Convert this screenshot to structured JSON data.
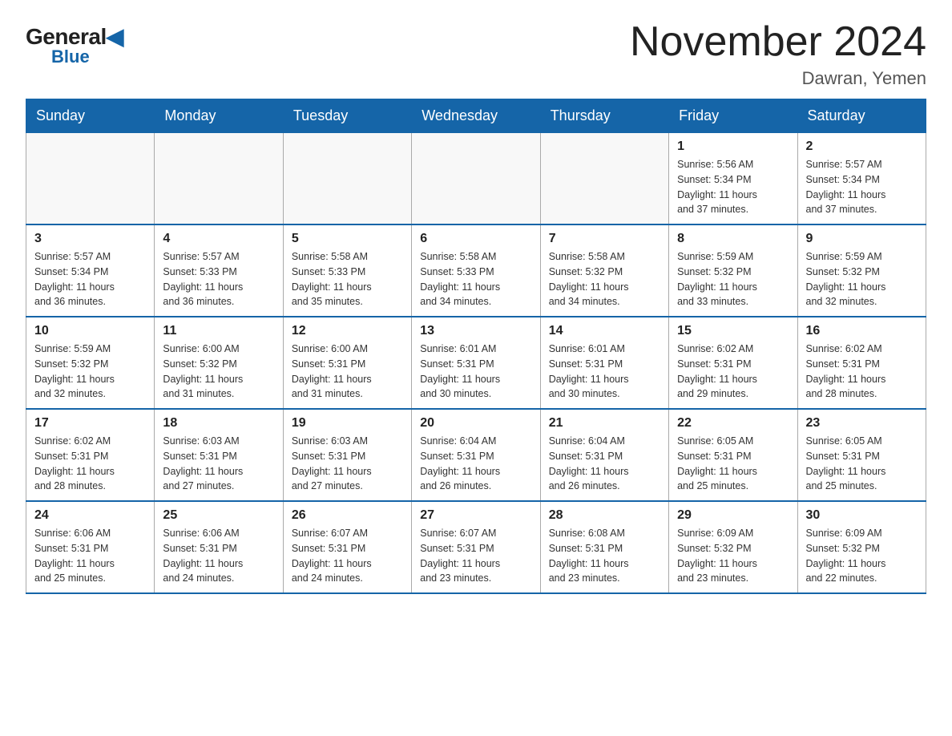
{
  "header": {
    "logo_general": "General",
    "logo_blue": "Blue",
    "month_title": "November 2024",
    "location": "Dawran, Yemen"
  },
  "days_of_week": [
    "Sunday",
    "Monday",
    "Tuesday",
    "Wednesday",
    "Thursday",
    "Friday",
    "Saturday"
  ],
  "weeks": [
    [
      {
        "day": "",
        "info": ""
      },
      {
        "day": "",
        "info": ""
      },
      {
        "day": "",
        "info": ""
      },
      {
        "day": "",
        "info": ""
      },
      {
        "day": "",
        "info": ""
      },
      {
        "day": "1",
        "info": "Sunrise: 5:56 AM\nSunset: 5:34 PM\nDaylight: 11 hours\nand 37 minutes."
      },
      {
        "day": "2",
        "info": "Sunrise: 5:57 AM\nSunset: 5:34 PM\nDaylight: 11 hours\nand 37 minutes."
      }
    ],
    [
      {
        "day": "3",
        "info": "Sunrise: 5:57 AM\nSunset: 5:34 PM\nDaylight: 11 hours\nand 36 minutes."
      },
      {
        "day": "4",
        "info": "Sunrise: 5:57 AM\nSunset: 5:33 PM\nDaylight: 11 hours\nand 36 minutes."
      },
      {
        "day": "5",
        "info": "Sunrise: 5:58 AM\nSunset: 5:33 PM\nDaylight: 11 hours\nand 35 minutes."
      },
      {
        "day": "6",
        "info": "Sunrise: 5:58 AM\nSunset: 5:33 PM\nDaylight: 11 hours\nand 34 minutes."
      },
      {
        "day": "7",
        "info": "Sunrise: 5:58 AM\nSunset: 5:32 PM\nDaylight: 11 hours\nand 34 minutes."
      },
      {
        "day": "8",
        "info": "Sunrise: 5:59 AM\nSunset: 5:32 PM\nDaylight: 11 hours\nand 33 minutes."
      },
      {
        "day": "9",
        "info": "Sunrise: 5:59 AM\nSunset: 5:32 PM\nDaylight: 11 hours\nand 32 minutes."
      }
    ],
    [
      {
        "day": "10",
        "info": "Sunrise: 5:59 AM\nSunset: 5:32 PM\nDaylight: 11 hours\nand 32 minutes."
      },
      {
        "day": "11",
        "info": "Sunrise: 6:00 AM\nSunset: 5:32 PM\nDaylight: 11 hours\nand 31 minutes."
      },
      {
        "day": "12",
        "info": "Sunrise: 6:00 AM\nSunset: 5:31 PM\nDaylight: 11 hours\nand 31 minutes."
      },
      {
        "day": "13",
        "info": "Sunrise: 6:01 AM\nSunset: 5:31 PM\nDaylight: 11 hours\nand 30 minutes."
      },
      {
        "day": "14",
        "info": "Sunrise: 6:01 AM\nSunset: 5:31 PM\nDaylight: 11 hours\nand 30 minutes."
      },
      {
        "day": "15",
        "info": "Sunrise: 6:02 AM\nSunset: 5:31 PM\nDaylight: 11 hours\nand 29 minutes."
      },
      {
        "day": "16",
        "info": "Sunrise: 6:02 AM\nSunset: 5:31 PM\nDaylight: 11 hours\nand 28 minutes."
      }
    ],
    [
      {
        "day": "17",
        "info": "Sunrise: 6:02 AM\nSunset: 5:31 PM\nDaylight: 11 hours\nand 28 minutes."
      },
      {
        "day": "18",
        "info": "Sunrise: 6:03 AM\nSunset: 5:31 PM\nDaylight: 11 hours\nand 27 minutes."
      },
      {
        "day": "19",
        "info": "Sunrise: 6:03 AM\nSunset: 5:31 PM\nDaylight: 11 hours\nand 27 minutes."
      },
      {
        "day": "20",
        "info": "Sunrise: 6:04 AM\nSunset: 5:31 PM\nDaylight: 11 hours\nand 26 minutes."
      },
      {
        "day": "21",
        "info": "Sunrise: 6:04 AM\nSunset: 5:31 PM\nDaylight: 11 hours\nand 26 minutes."
      },
      {
        "day": "22",
        "info": "Sunrise: 6:05 AM\nSunset: 5:31 PM\nDaylight: 11 hours\nand 25 minutes."
      },
      {
        "day": "23",
        "info": "Sunrise: 6:05 AM\nSunset: 5:31 PM\nDaylight: 11 hours\nand 25 minutes."
      }
    ],
    [
      {
        "day": "24",
        "info": "Sunrise: 6:06 AM\nSunset: 5:31 PM\nDaylight: 11 hours\nand 25 minutes."
      },
      {
        "day": "25",
        "info": "Sunrise: 6:06 AM\nSunset: 5:31 PM\nDaylight: 11 hours\nand 24 minutes."
      },
      {
        "day": "26",
        "info": "Sunrise: 6:07 AM\nSunset: 5:31 PM\nDaylight: 11 hours\nand 24 minutes."
      },
      {
        "day": "27",
        "info": "Sunrise: 6:07 AM\nSunset: 5:31 PM\nDaylight: 11 hours\nand 23 minutes."
      },
      {
        "day": "28",
        "info": "Sunrise: 6:08 AM\nSunset: 5:31 PM\nDaylight: 11 hours\nand 23 minutes."
      },
      {
        "day": "29",
        "info": "Sunrise: 6:09 AM\nSunset: 5:32 PM\nDaylight: 11 hours\nand 23 minutes."
      },
      {
        "day": "30",
        "info": "Sunrise: 6:09 AM\nSunset: 5:32 PM\nDaylight: 11 hours\nand 22 minutes."
      }
    ]
  ]
}
